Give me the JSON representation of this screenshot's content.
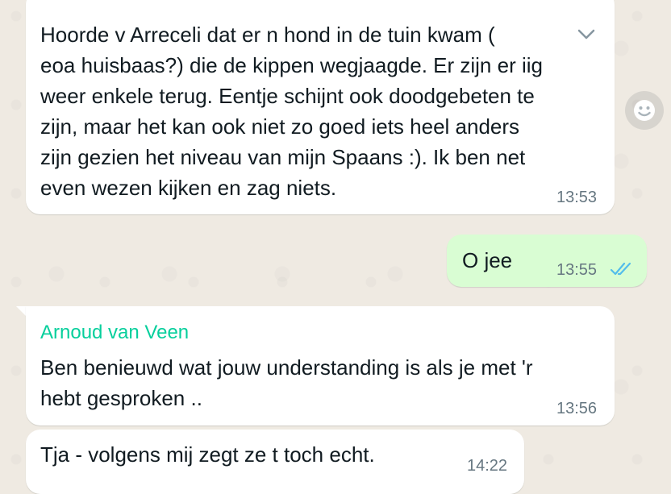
{
  "messages": [
    {
      "direction": "incoming",
      "text": "Hoorde v Arreceli dat er n hond in de tuin kwam (\neoa huisbaas?) die de kippen wegjaagde. Er zijn er iig\nweer enkele terug. Eentje schijnt ook doodgebeten te\nzijn, maar het kan ook niet zo goed iets heel anders\nzijn gezien het niveau van mijn Spaans :). Ik ben net\neven wezen kijken en zag niets.",
      "time": "13:53"
    },
    {
      "direction": "outgoing",
      "text": "O jee",
      "time": "13:55",
      "status": "read"
    },
    {
      "direction": "incoming",
      "sender": "Arnoud van Veen",
      "text": "Ben benieuwd wat jouw understanding is als je met 'r\nhebt gesproken ..",
      "time": "13:56"
    },
    {
      "direction": "incoming",
      "text": "Tja - volgens mij zegt ze t toch echt.",
      "time": "14:22"
    }
  ],
  "icons": {
    "message_menu": "chevron-down-icon",
    "reaction": "emoji-icon",
    "read_receipt": "double-check-icon"
  },
  "colors": {
    "background": "#efeae2",
    "incoming_bubble": "#ffffff",
    "outgoing_bubble": "#d9fdd3",
    "sender_name": "#06cf9c",
    "read_ticks": "#53bdeb",
    "timestamp": "#667781"
  }
}
